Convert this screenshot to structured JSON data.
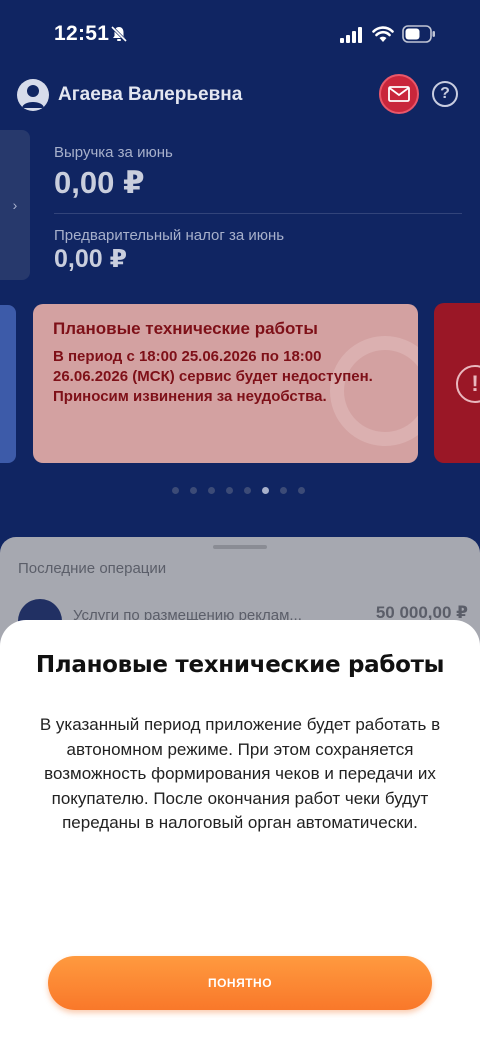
{
  "status_bar": {
    "time": "12:51",
    "icons": [
      "bell-off-icon",
      "signal-icon",
      "wifi-icon",
      "battery-icon"
    ]
  },
  "header": {
    "user_name": "Агаева             Валерьевна",
    "icons": [
      "avatar-icon",
      "mail-icon",
      "help-icon"
    ],
    "help_glyph": "?"
  },
  "summary": {
    "arrow": "›",
    "revenue_label": "Выручка за июнь",
    "revenue_value": "0,00 ₽",
    "tax_label": "Предварительный налог за июнь",
    "tax_value": "0,00 ₽"
  },
  "notice": {
    "title": "Плановые технические работы",
    "text": "В период с 18:00 25.06.2026 по 18:00 26.06.2026 (МСК) сервис будет недоступен. Приносим извинения за неудобства.",
    "right_card_glyph": "!",
    "dots_total": 8,
    "dots_active_index": 5
  },
  "operations": {
    "title": "Последние операции",
    "items": [
      {
        "name": "Услуги по размещению реклам...",
        "amount": "50 000,00 ₽"
      }
    ]
  },
  "modal": {
    "title": "Плановые технические работы",
    "text": "В указанный период приложение будет работать в автономном режиме. При этом сохраняется возможность формирования чеков и передачи их покупателю. После окончания работ чеки будут переданы в налоговый орган автоматически.",
    "button_label": "ПОНЯТНО"
  },
  "colors": {
    "background": "#102562",
    "accent_orange": "#f9782a",
    "mail_red": "#c9263b",
    "notice_text": "#7e1018"
  }
}
